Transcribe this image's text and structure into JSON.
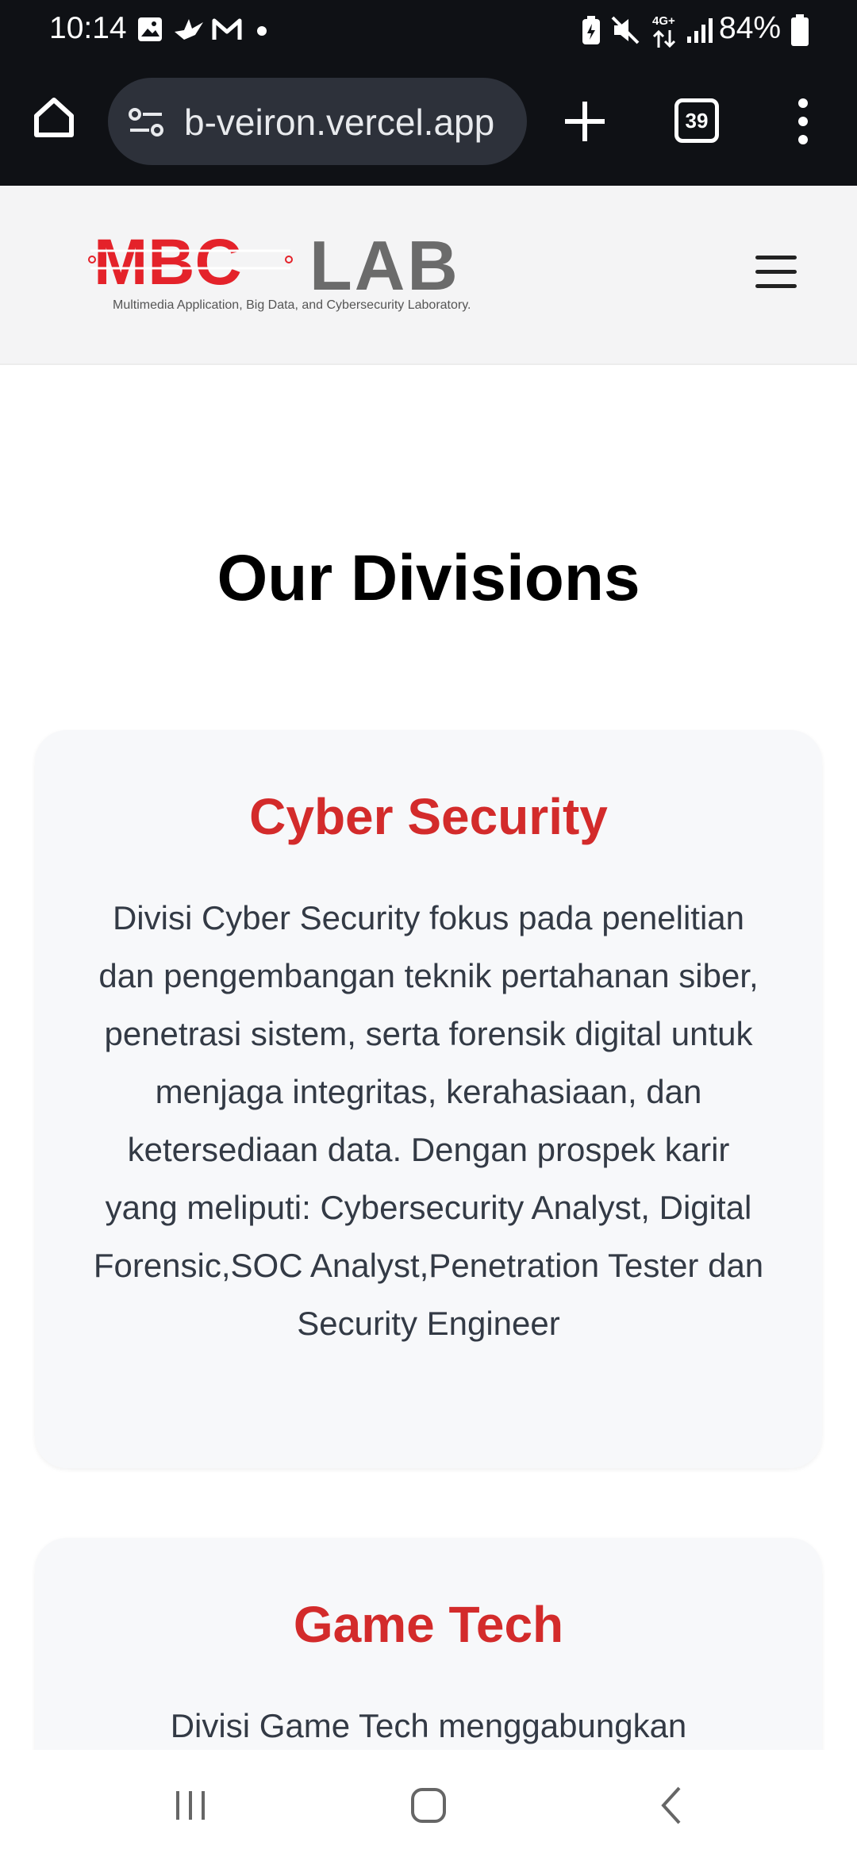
{
  "status_bar": {
    "time": "10:14",
    "battery_percent": "84%",
    "network_label": "4G+",
    "icons": [
      "gallery-icon",
      "bird-notification-icon",
      "gmail-icon",
      "more-dot-icon",
      "battery-saver-icon",
      "mute-icon",
      "data-arrows-icon",
      "signal-icon",
      "battery-icon"
    ]
  },
  "browser": {
    "url": "b-veiron.vercel.app",
    "tab_count": "39",
    "icons": [
      "home-icon",
      "site-settings-icon",
      "new-tab-icon",
      "tab-switcher-icon",
      "overflow-menu-icon"
    ]
  },
  "site": {
    "logo_brand": "MBC",
    "logo_lab": "LAB",
    "logo_tagline": "Multimedia  Application, Big Data, and Cybersecurity Laboratory.",
    "brand_color": "#e4222a"
  },
  "main": {
    "title": "Our Divisions",
    "divisions": [
      {
        "name": "Cyber Security",
        "description": "Divisi Cyber Security fokus pada penelitian dan pengembangan teknik pertahanan siber, penetrasi sistem, serta forensik digital untuk menjaga integritas, kerahasiaan, dan ketersediaan data. Dengan prospek karir yang meliputi: Cybersecurity Analyst, Digital Forensic,SOC Analyst,Penetration Tester dan Security Engineer"
      },
      {
        "name": "Game Tech",
        "description": "Divisi Game Tech menggabungkan"
      }
    ]
  },
  "system_nav": {
    "icons": [
      "recents-icon",
      "home-nav-icon",
      "back-icon"
    ]
  },
  "colors": {
    "accent_red": "#d32b2b",
    "toolbar_bg": "#0f1115",
    "header_bg": "#f4f4f5",
    "card_bg": "#f7f8fa"
  }
}
